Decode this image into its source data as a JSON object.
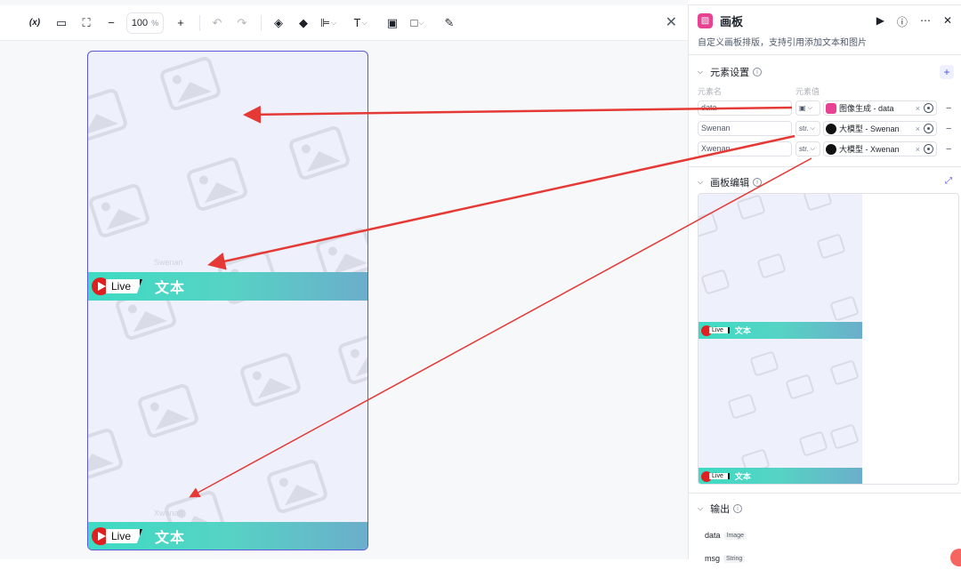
{
  "toolbar": {
    "variable_icon": "(x)",
    "zoom_value": "100",
    "zoom_unit": "%",
    "close": "✕"
  },
  "canvas": {
    "banner_live": "Live",
    "banner_text": "文本",
    "ghost_label_1": "Swenan",
    "ghost_label_2": "Xwenan"
  },
  "panel": {
    "title": "画板",
    "subtitle": "自定义画板排版，支持引用添加文本和图片",
    "elements_section": "元素设置",
    "col_name": "元素名",
    "col_value": "元素值",
    "rows": [
      {
        "name": "data",
        "type": "",
        "value": "图像生成 - data",
        "icon": "pink"
      },
      {
        "name": "Swenan",
        "type": "str.",
        "value": "大模型 - Swenan",
        "icon": "black"
      },
      {
        "name": "Xwenan",
        "type": "str.",
        "value": "大模型 - Xwenan",
        "icon": "black"
      }
    ],
    "editor_section": "画板编辑",
    "preview_live": "Live",
    "preview_text": "文本",
    "output_section": "输出",
    "outputs": [
      {
        "name": "data",
        "type": "Image"
      },
      {
        "name": "msg",
        "type": "String"
      }
    ]
  },
  "colors": {
    "accent": "#4d53e8",
    "arrow": "#e53935",
    "banner_start": "#3ddbc3",
    "banner_end": "#6baecb"
  }
}
